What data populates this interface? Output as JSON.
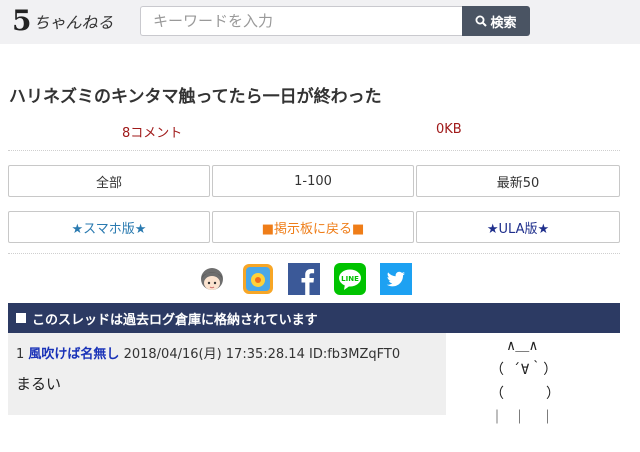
{
  "header": {
    "logo_mark": "5",
    "logo_text": "ちゃんねる",
    "search_placeholder": "キーワードを入力",
    "search_button_label": "検索",
    "search_icon": "search-icon"
  },
  "thread": {
    "title": "ハリネズミのキンタマ触ってたら一日が終わった",
    "comment_count": "8コメント",
    "size": "0KB"
  },
  "nav_buttons": {
    "all": "全部",
    "range": "1-100",
    "latest": "最新50"
  },
  "link_buttons": {
    "smartphone": "★スマホ版★",
    "back_to_board": "■掲示板に戻る■",
    "ula": "★ULA版★"
  },
  "share": {
    "items": [
      "avatar-icon",
      "app-icon",
      "facebook-icon",
      "line-icon",
      "twitter-icon"
    ],
    "line_label": "LINE",
    "facebook_color": "#3b5998",
    "line_color": "#00c300",
    "twitter_color": "#1da1f2"
  },
  "archive_notice": "このスレッドは過去ログ倉庫に格納されています",
  "posts": [
    {
      "number": "1",
      "name": "風吹けば名無し",
      "date": "2018/04/16(月) 17:35:28.14",
      "id": "ID:fb3MZqFT0",
      "body": "まるい"
    }
  ],
  "ascii_art": "  ∧＿∧\n（ ´∀｀）\n（　　　）\n｜ ｜　｜"
}
